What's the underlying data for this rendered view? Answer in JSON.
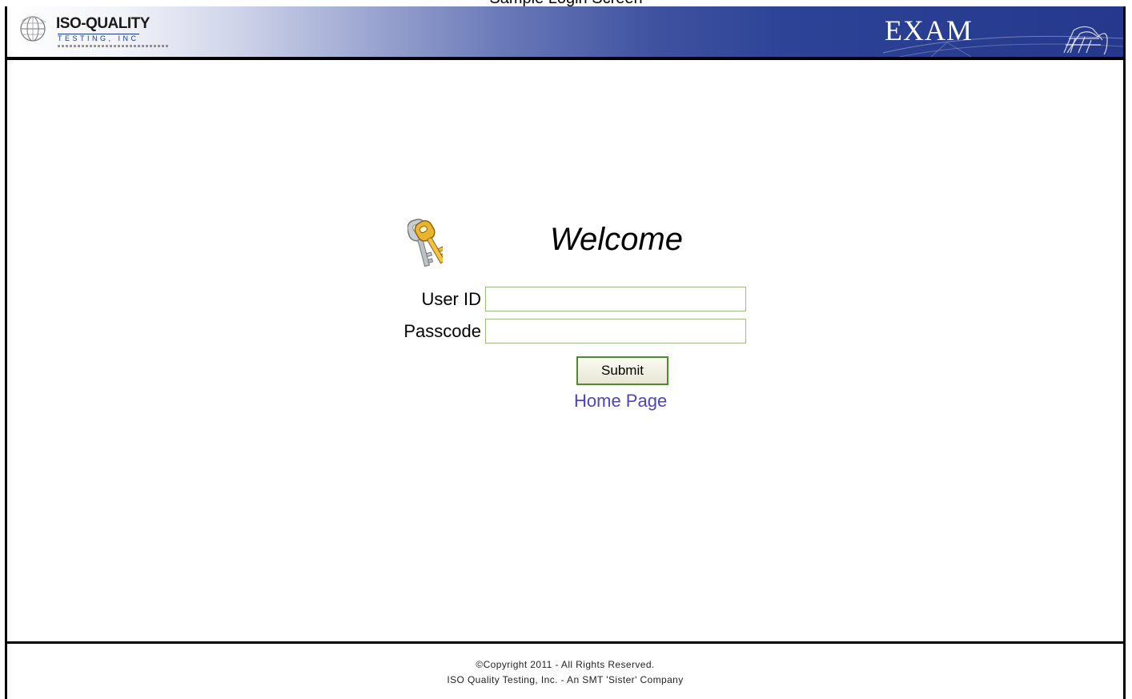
{
  "page": {
    "caption": "Sample Login Screen"
  },
  "header": {
    "logo_main": "ISO-QUALITY",
    "logo_sub": "TESTING, INC",
    "exam_title": "EXAM",
    "icons": {
      "logo": "globe-icon",
      "decoration": "globe-outline-icon"
    },
    "colors": {
      "gradient_start": "#ffffff",
      "gradient_end": "#25388c"
    }
  },
  "login": {
    "welcome": "Welcome",
    "key_icon": "keys-icon",
    "user_id_label": "User ID",
    "user_id_value": "",
    "passcode_label": "Passcode",
    "passcode_value": "",
    "submit_label": "Submit",
    "home_link": "Home Page"
  },
  "footer": {
    "copyright": "©Copyright 2011 - All Rights Reserved.",
    "company": "ISO Quality Testing, Inc. - An SMT 'Sister' Company"
  }
}
